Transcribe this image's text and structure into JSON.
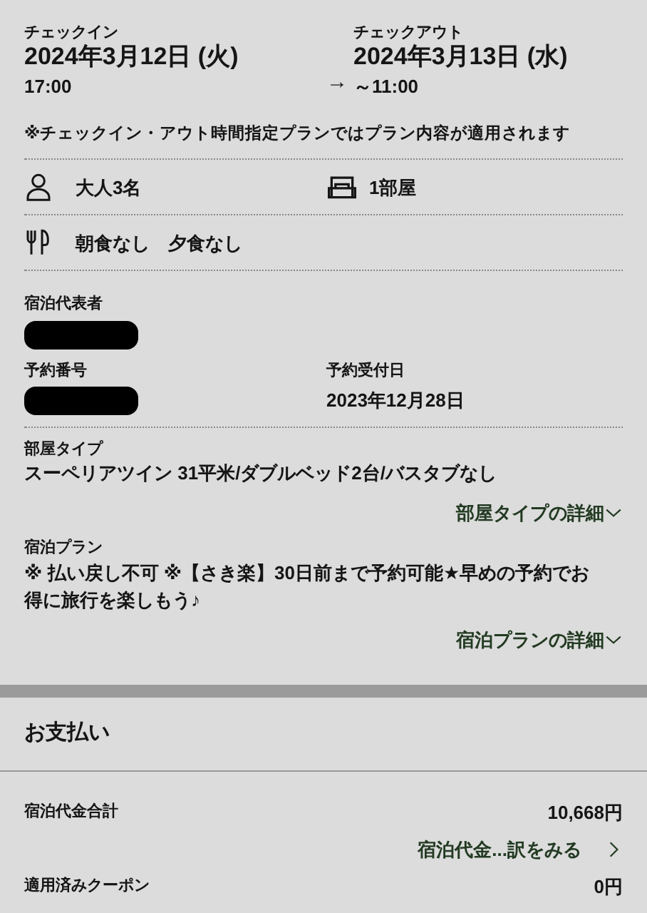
{
  "stay": {
    "checkin": {
      "label": "チェックイン",
      "date": "2024年3月12日 (火)",
      "time": "17:00"
    },
    "arrow": "→",
    "checkout": {
      "label": "チェックアウト",
      "date": "2024年3月13日 (水)",
      "time": "～11:00"
    },
    "note": "※チェックイン・アウト時間指定プランではプラン内容が適用されます"
  },
  "guests": "大人3名",
  "rooms": "1部屋",
  "meals": "朝食なし　夕食なし",
  "representative": {
    "label": "宿泊代表者",
    "redacted": true
  },
  "reservation_number": {
    "label": "予約番号",
    "redacted": true
  },
  "reservation_date": {
    "label": "予約受付日",
    "value": "2023年12月28日"
  },
  "room_type": {
    "label": "部屋タイプ",
    "value": "スーペリアツイン 31平米/ダブルベッド2台/バスタブなし",
    "link": "部屋タイプの詳細",
    "expanded": false
  },
  "plan": {
    "label": "宿泊プラン",
    "value": "※ 払い戻し不可 ※【さき楽】30日前まで予約可能★早めの予約でお得に旅行を楽しもう♪",
    "link": "宿泊プランの詳細",
    "expanded": false
  },
  "payment": {
    "title": "お支払い",
    "rows": [
      {
        "kind": "amount",
        "label": "宿泊代金合計",
        "value": "10,668円"
      },
      {
        "kind": "link",
        "label": "宿泊代金...訳をみる"
      },
      {
        "kind": "amount",
        "label": "適用済みクーポン",
        "value": "0円"
      }
    ]
  }
}
